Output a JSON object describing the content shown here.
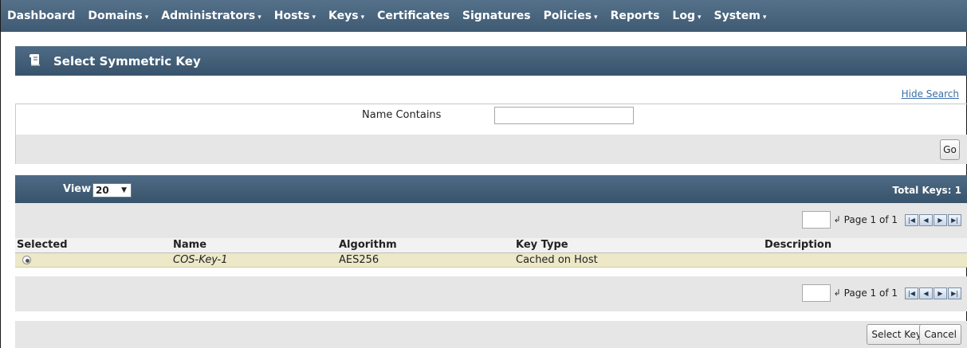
{
  "nav": {
    "items": [
      {
        "label": "Dashboard",
        "dropdown": false
      },
      {
        "label": "Domains",
        "dropdown": true
      },
      {
        "label": "Administrators",
        "dropdown": true
      },
      {
        "label": "Hosts",
        "dropdown": true
      },
      {
        "label": "Keys",
        "dropdown": true
      },
      {
        "label": "Certificates",
        "dropdown": false
      },
      {
        "label": "Signatures",
        "dropdown": false
      },
      {
        "label": "Policies",
        "dropdown": true
      },
      {
        "label": "Reports",
        "dropdown": false
      },
      {
        "label": "Log",
        "dropdown": true
      },
      {
        "label": "System",
        "dropdown": true
      }
    ],
    "dropdown_arrow": "▾"
  },
  "header": {
    "title": "Select Symmetric Key",
    "icon": "scroll-icon"
  },
  "search": {
    "hide_link": "Hide Search",
    "label": "Name Contains",
    "value": "",
    "go_label": "Go"
  },
  "list": {
    "view_label": "View",
    "view_value": "20",
    "total_text": "Total Keys: 1"
  },
  "pager": {
    "page_text": "Page 1 of 1",
    "input_value": "",
    "buttons": [
      "first",
      "previous",
      "next",
      "last"
    ]
  },
  "table": {
    "columns": [
      "Selected",
      "Name",
      "Algorithm",
      "Key Type",
      "Description"
    ],
    "rows": [
      {
        "selected": true,
        "name": "COS-Key-1",
        "algorithm": "AES256",
        "key_type": "Cached on Host",
        "description": ""
      }
    ]
  },
  "actions": {
    "select_label": "Select Key",
    "cancel_label": "Cancel"
  },
  "colors": {
    "nav_bg": "#4a657e",
    "title_bg": "#3f5a72",
    "row_highlight": "#ece8c8",
    "band_gray": "#e6e6e6",
    "link": "#3a6ea5"
  }
}
